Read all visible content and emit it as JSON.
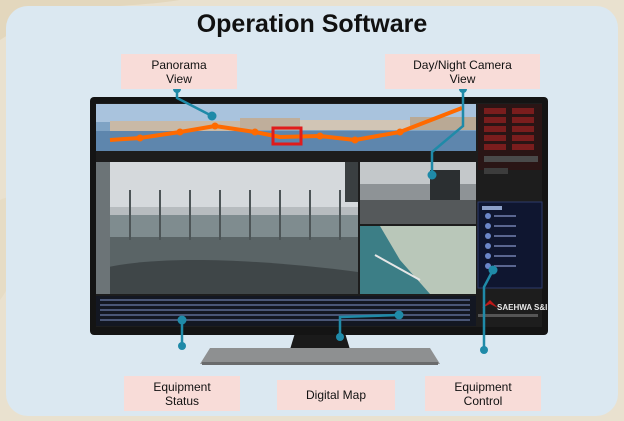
{
  "title": "Operation Software",
  "callouts": {
    "panorama": "Panorama View",
    "daynight": "Day/Night Camera View",
    "equipment_status": "Equipment Status",
    "digital_map": "Digital Map",
    "equipment_control": "Equipment Control"
  },
  "brand": "SAEHWA S&I",
  "colors": {
    "panel_bg": "#dbe8f1",
    "callout_bg": "#f8dcd8",
    "connector": "#1f8aa8",
    "track": "#ff6a00",
    "highlight": "#e01b1b"
  }
}
